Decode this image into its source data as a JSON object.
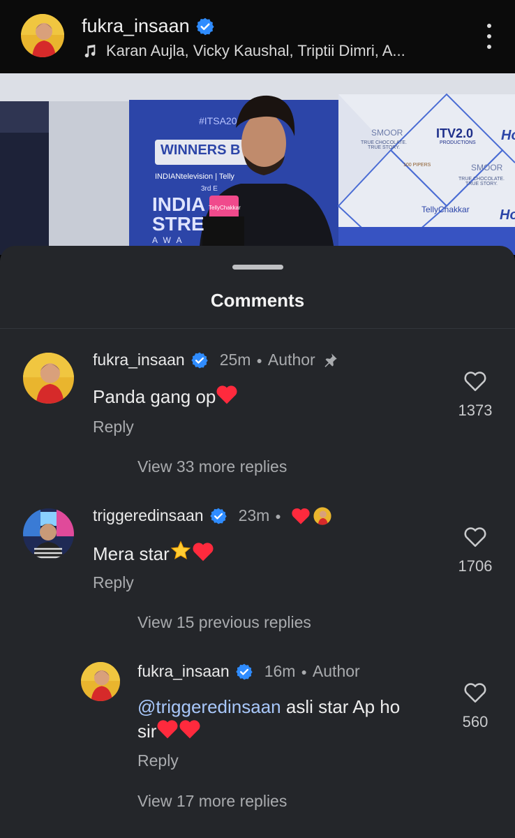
{
  "header": {
    "username": "fukra_insaan",
    "verified_icon": "verified-badge-icon",
    "music_icon": "music-note-icon",
    "music_text": "Karan Aujla, Vicky Kaushal, Triptii Dimri, A...",
    "menu_icon": "more-vertical-icon"
  },
  "video": {
    "banner_hashtag": "#ITSA20",
    "banner_winners": "WINNERS B",
    "banner_network": "INDIANtelevision | Telly",
    "banner_edition": "3rd E",
    "banner_india": "INDIA",
    "banner_stre": "STRE",
    "banner_awa": "AWA",
    "mic_label": "TellyChakkar",
    "brand_smoor": "SMOOR",
    "brand_tagline": "TRUE CHOCOLATE. TRUE STORY.",
    "brand_itv": "ITV2.0",
    "brand_itv_sub": "PRODUCTIONS",
    "brand_telly": "TellyChakkar",
    "brand_pipers": "100 PIPERS",
    "brand_partial": "Ho"
  },
  "sheet": {
    "title": "Comments"
  },
  "comments": [
    {
      "username": "fukra_insaan",
      "time": "25m",
      "tag": "Author",
      "text": "Panda gang op",
      "reply_label": "Reply",
      "likes": "1373",
      "view_more": "View 33 more replies"
    },
    {
      "username": "triggeredinsaan",
      "time": "23m",
      "text": "Mera star",
      "reply_label": "Reply",
      "likes": "1706",
      "view_more": "View 15 previous replies"
    },
    {
      "username": "fukra_insaan",
      "time": "16m",
      "tag": "Author",
      "mention": "@triggeredinsaan",
      "text_line1": " asli star Ap ho",
      "text_line2": "sir",
      "reply_label": "Reply",
      "likes": "560",
      "view_more": "View 17 more replies"
    }
  ],
  "colors": {
    "verified": "#2f8cff",
    "heart": "#ff2a3d",
    "mention": "#a8c7fa",
    "sheet_bg": "#24262a"
  }
}
